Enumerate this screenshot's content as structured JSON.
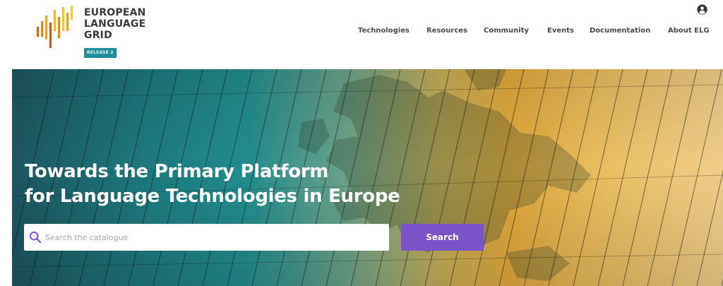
{
  "logo": {
    "line1": "EUROPEAN",
    "line2": "LANGUAGE",
    "line3": "GRID",
    "badge": "RELEASE 2"
  },
  "nav": {
    "items": [
      {
        "label": "Technologies"
      },
      {
        "label": "Resources"
      },
      {
        "label": "Community"
      },
      {
        "label": "Events"
      },
      {
        "label": "Documentation"
      },
      {
        "label": "About ELG"
      }
    ]
  },
  "hero": {
    "title_line1": "Towards the Primary Platform",
    "title_line2": "for Language Technologies in Europe"
  },
  "search": {
    "placeholder": "Search the catalogue",
    "value": "",
    "button_label": "Search"
  },
  "icons": {
    "user": "user-circle-icon",
    "search": "magnifier-icon"
  },
  "colors": {
    "badge": "#1e8e98",
    "search_button": "#7b54c9",
    "search_icon": "#7b54c9",
    "nav_text": "#4a4a4a"
  }
}
